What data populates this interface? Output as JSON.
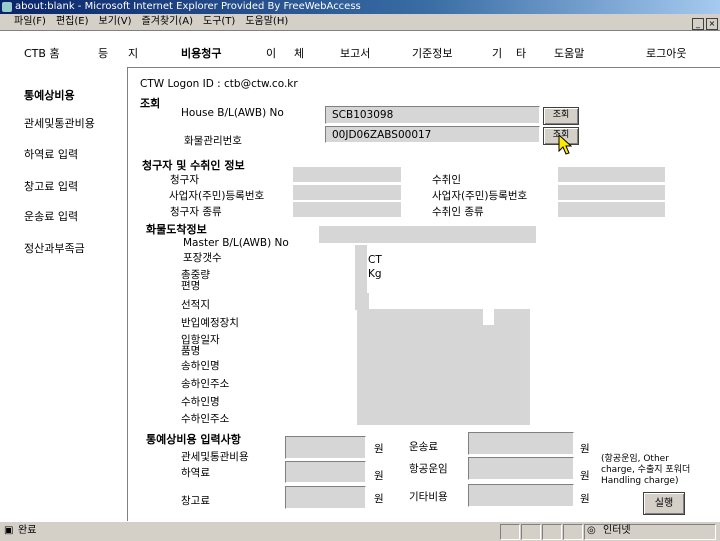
{
  "window": {
    "title": "about:blank - Microsoft Internet Explorer Provided By FreeWebAccess"
  },
  "menu": [
    "파일(F)",
    "편집(E)",
    "보기(V)",
    "즐겨찾기(A)",
    "도구(T)",
    "도움말(H)"
  ],
  "topnav": {
    "items": [
      "CTB 홈",
      "등",
      "지",
      "비용청구",
      "이",
      "체",
      "보고서",
      "기준정보",
      "기",
      "타",
      "도움말",
      "로그아웃"
    ]
  },
  "leftnav": [
    "통예상비용",
    "관세및통관비용",
    "하역료 입력",
    "창고료 입력",
    "운송료 입력",
    "정산과부족금"
  ],
  "logon": "CTW Logon ID : ctb@ctw.co.kr",
  "inquiry": {
    "title": "조회",
    "hbl_label": "House B/L(AWB) No",
    "hbl_value": "SCB103098",
    "cargo_label": "화물관리번호",
    "cargo_value": "00JD06ZABS00017",
    "btn": "조회"
  },
  "claimant": {
    "title": "청구자 및 수취인 정보",
    "claimant_label": "청구자",
    "reg_label": "사업자(주민)등록번호",
    "type_label": "청구자 종류",
    "recipient_label": "수취인",
    "recipient_reg_label": "사업자(주민)등록번호",
    "recipient_type_label": "수취인 종류"
  },
  "arrival": {
    "title": "화물도착정보",
    "labels": [
      "Master B/L(AWB) No",
      "포장갯수",
      "총중량",
      "편명",
      "선적지",
      "반입예정장치",
      "입항일자",
      "품명",
      "송하인명",
      "송하인주소",
      "수하인명",
      "수하인주소"
    ],
    "pkg_unit": "CT",
    "weight_unit": "Kg"
  },
  "cost": {
    "title": "통예상비용 입력사항",
    "customs_label": "관세및통관비용",
    "handling_label": "하역료",
    "storage_label": "창고료",
    "transport_label": "운송료",
    "airfare_label": "항공운임",
    "other_label": "기타비용",
    "won": "원",
    "note": "(항공운임, Other charge, 수출지 포워더 Handling charge)",
    "run_btn": "실행"
  },
  "status": {
    "left": "완료",
    "zone": "인터넷"
  }
}
